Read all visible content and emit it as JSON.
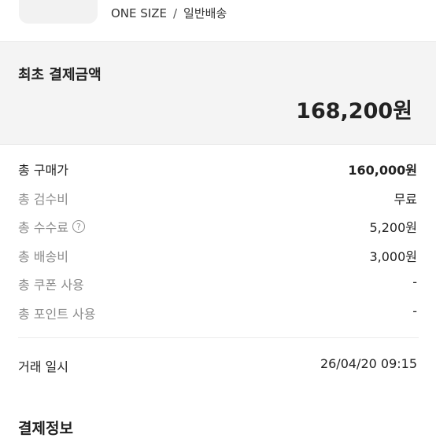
{
  "product": {
    "thumbnail_icon": "product-image-icon",
    "size": "ONE SIZE",
    "separator": "/",
    "delivery": "일반배송"
  },
  "initial_payment": {
    "label": "최초 결제금액",
    "amount": "168,200원"
  },
  "price_rows": [
    {
      "label": "총 구매가",
      "value": "160,000원"
    },
    {
      "label": "총 검수비",
      "value": "무료"
    },
    {
      "label": "총 수수료",
      "value": "5,200원",
      "help_icon": "question-circle-icon"
    },
    {
      "label": "총 배송비",
      "value": "3,000원"
    },
    {
      "label": "총 쿠폰 사용",
      "value": "-"
    },
    {
      "label": "총 포인트 사용",
      "value": "-"
    }
  ],
  "trade": {
    "label": "거래 일시",
    "value": "26/04/20 09:15"
  },
  "payment_info": {
    "title": "결제정보"
  },
  "colors": {
    "summary_background": "#f4f4f4",
    "muted_label": "#8c8c8c",
    "text": "#222222"
  }
}
